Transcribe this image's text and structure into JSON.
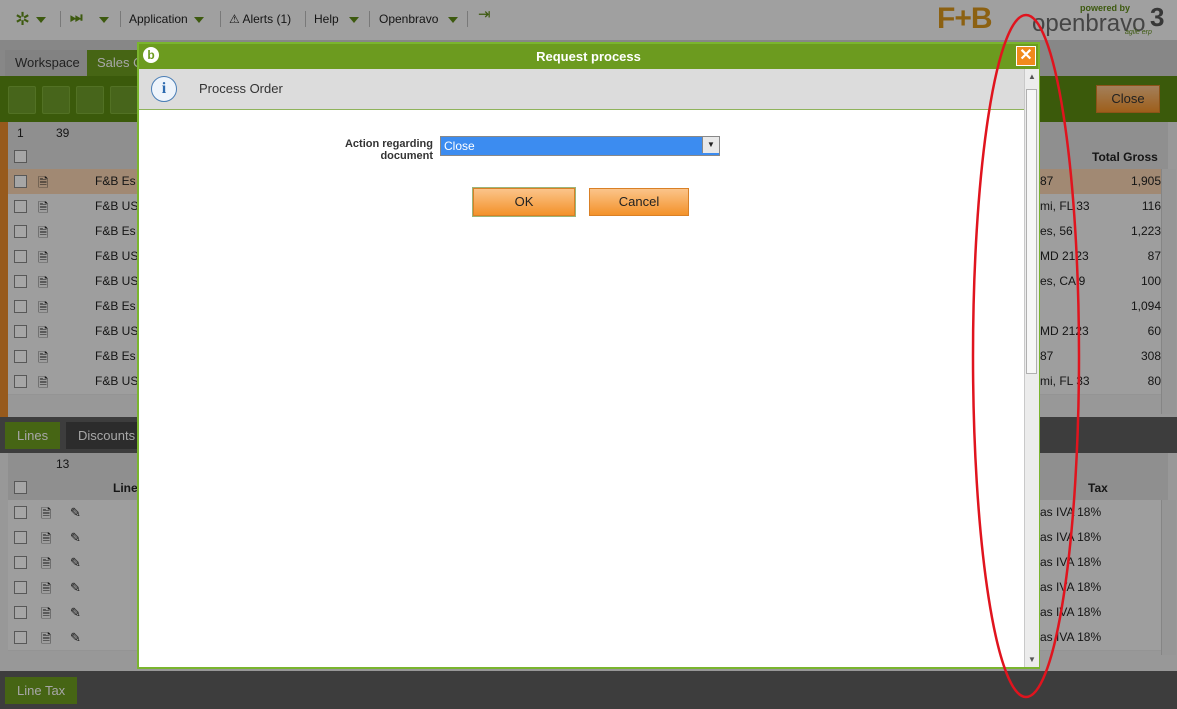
{
  "navbar": {
    "application": "Application",
    "alerts": "Alerts (1)",
    "help": "Help",
    "openbravo": "Openbravo",
    "brand_logo": "F+B",
    "powered_by": "powered by",
    "vendor": "openbravo",
    "version": "3",
    "tagline": "agile erp"
  },
  "tabs": {
    "workspace": "Workspace",
    "sales_order": "Sales O"
  },
  "toolbar": {
    "close_label": "Close"
  },
  "header_grid": {
    "page": "1",
    "count": "39",
    "total_gross_header": "Total Gross",
    "rows": [
      {
        "org": "F&B Es",
        "address": "87",
        "total": "1,905"
      },
      {
        "org": "F&B US",
        "address": "mi, FL 33",
        "total": "116"
      },
      {
        "org": "F&B Es",
        "address": "es, 56",
        "total": "1,223"
      },
      {
        "org": "F&B US",
        "address": "MD 2123",
        "total": "87"
      },
      {
        "org": "F&B US",
        "address": "es, CA 9",
        "total": "100"
      },
      {
        "org": "F&B Es",
        "address": "",
        "total": "1,094"
      },
      {
        "org": "F&B US",
        "address": "MD 2123",
        "total": "60"
      },
      {
        "org": "F&B Es",
        "address": "87",
        "total": "308"
      },
      {
        "org": "F&B US",
        "address": "mi, FL 33",
        "total": "80"
      }
    ]
  },
  "sub_tabs": {
    "lines": "Lines",
    "discounts": "Discounts"
  },
  "lines_grid": {
    "count": "13",
    "line_header": "Line",
    "tax_header": "Tax",
    "tax_rows": [
      "as IVA 18%",
      "as IVA 18%",
      "as IVA 18%",
      "as IVA 18%",
      "as IVA 18%",
      "as IVA 18%"
    ]
  },
  "bottom_tab": {
    "line_tax": "Line Tax"
  },
  "dialog": {
    "title": "Request process",
    "subtitle": "Process Order",
    "field_label": "Action regarding document",
    "selected_action": "Close",
    "ok_label": "OK",
    "cancel_label": "Cancel"
  },
  "colors": {
    "brand_green": "#6c9b1f",
    "accent_orange": "#f3922a",
    "selection_blue": "#3c8cf0",
    "annotation_red": "#e0141e"
  }
}
